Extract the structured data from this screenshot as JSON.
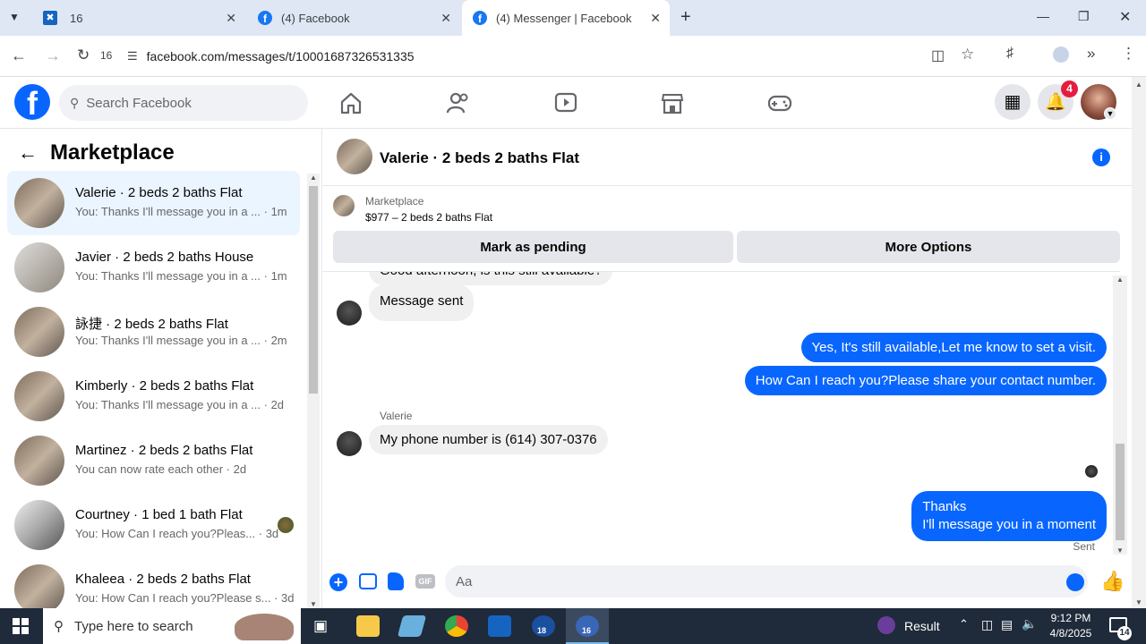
{
  "browser": {
    "tabs": [
      {
        "label": "16",
        "icon": "app-icon"
      },
      {
        "label": "(4) Facebook",
        "icon": "facebook-icon"
      },
      {
        "label": "(4) Messenger | Facebook",
        "icon": "facebook-icon"
      }
    ],
    "reload_badge": "16",
    "url": "facebook.com/messages/t/10001687326531335"
  },
  "fb": {
    "search_placeholder": "Search Facebook",
    "notif_count": "4"
  },
  "sidebar": {
    "title": "Marketplace",
    "conversations": [
      {
        "name": "Valerie · 2 beds 2 baths Flat",
        "preview": "You: Thanks I'll message you in a ...",
        "time": "· 1m"
      },
      {
        "name": "Javier · 2 beds 2 baths House",
        "preview": "You: Thanks I'll message you in a ...",
        "time": "· 1m"
      },
      {
        "name": "詠捷 · 2 beds 2 baths Flat",
        "preview": "You: Thanks I'll message you in a ...",
        "time": "· 2m"
      },
      {
        "name": "Kimberly · 2 beds 2 baths Flat",
        "preview": "You: Thanks I'll message you in a ...",
        "time": "· 2d"
      },
      {
        "name": "Martinez · 2 beds 2 baths Flat",
        "preview": "You can now rate each other",
        "time": "· 2d"
      },
      {
        "name": "Courtney · 1 bed 1 bath Flat",
        "preview": "You: How Can I reach you?Pleas...",
        "time": "· 3d"
      },
      {
        "name": "Khaleea · 2 beds 2 baths Flat",
        "preview": "You: How Can I reach you?Please s...",
        "time": "· 3d"
      }
    ]
  },
  "chat": {
    "header_name": "Valerie · 2 beds 2 baths Flat",
    "listing_source": "Marketplace",
    "listing_title": "$977 – 2 beds 2 baths Flat",
    "mark_pending_label": "Mark as pending",
    "more_options_label": "More Options",
    "partial_message": "Good afternoon, is this still available?",
    "messages": [
      {
        "from": "other",
        "text": "Message sent"
      },
      {
        "from": "me",
        "text": "Yes, It's still available,Let me know to set a visit."
      },
      {
        "from": "me",
        "text": "How Can I reach you?Please share your contact number."
      },
      {
        "from": "other",
        "sender": "Valerie",
        "text": "My phone number is (614) 307-0376"
      },
      {
        "from": "me",
        "text_line1": "Thanks",
        "text_line2": "I'll message you in a moment"
      }
    ],
    "sent_status": "Sent",
    "composer_placeholder": "Aa",
    "gif_label": "GIF"
  },
  "taskbar": {
    "search_placeholder": "Type here to search",
    "result_label": "Result",
    "time": "9:12 PM",
    "date": "4/8/2025",
    "notif_count": "14",
    "app_badges": [
      "18",
      "16"
    ]
  }
}
